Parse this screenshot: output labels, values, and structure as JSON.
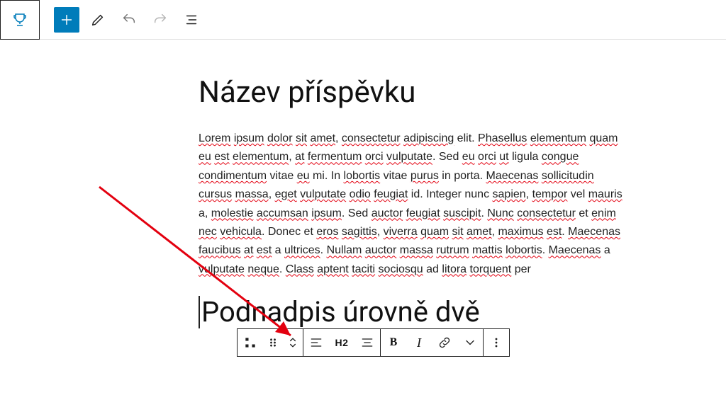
{
  "title": "Název příspěvku",
  "paragraph_spans": [
    {
      "t": "Lorem",
      "s": 1
    },
    {
      "t": " ",
      "s": 0
    },
    {
      "t": "ipsum",
      "s": 1
    },
    {
      "t": " ",
      "s": 0
    },
    {
      "t": "dolor",
      "s": 1
    },
    {
      "t": " ",
      "s": 0
    },
    {
      "t": "sit",
      "s": 1
    },
    {
      "t": " ",
      "s": 0
    },
    {
      "t": "amet",
      "s": 1
    },
    {
      "t": ", ",
      "s": 0
    },
    {
      "t": "consectetur",
      "s": 1
    },
    {
      "t": " ",
      "s": 0
    },
    {
      "t": "adipiscing",
      "s": 1
    },
    {
      "t": " elit. ",
      "s": 0
    },
    {
      "t": "Phasellus",
      "s": 1
    },
    {
      "t": " ",
      "s": 0
    },
    {
      "t": "elementum",
      "s": 1
    },
    {
      "t": " ",
      "s": 0
    },
    {
      "t": "quam",
      "s": 1
    },
    {
      "t": " ",
      "s": 0
    },
    {
      "t": "eu",
      "s": 1
    },
    {
      "t": " ",
      "s": 0
    },
    {
      "t": "est",
      "s": 1
    },
    {
      "t": " ",
      "s": 0
    },
    {
      "t": "elementum",
      "s": 1
    },
    {
      "t": ", ",
      "s": 0
    },
    {
      "t": "at",
      "s": 1
    },
    {
      "t": " ",
      "s": 0
    },
    {
      "t": "fermentum",
      "s": 1
    },
    {
      "t": " ",
      "s": 0
    },
    {
      "t": "orci",
      "s": 1
    },
    {
      "t": " ",
      "s": 0
    },
    {
      "t": "vulputate",
      "s": 1
    },
    {
      "t": ". Sed ",
      "s": 0
    },
    {
      "t": "eu",
      "s": 1
    },
    {
      "t": " ",
      "s": 0
    },
    {
      "t": "orci",
      "s": 1
    },
    {
      "t": " ",
      "s": 0
    },
    {
      "t": "ut",
      "s": 1
    },
    {
      "t": " ligula ",
      "s": 0
    },
    {
      "t": "congue",
      "s": 1
    },
    {
      "t": " ",
      "s": 0
    },
    {
      "t": "condimentum",
      "s": 1
    },
    {
      "t": " vitae ",
      "s": 0
    },
    {
      "t": "eu",
      "s": 1
    },
    {
      "t": " mi. In ",
      "s": 0
    },
    {
      "t": "lobortis",
      "s": 1
    },
    {
      "t": " vitae ",
      "s": 0
    },
    {
      "t": "purus",
      "s": 1
    },
    {
      "t": " in porta. ",
      "s": 0
    },
    {
      "t": "Maecenas",
      "s": 1
    },
    {
      "t": " ",
      "s": 0
    },
    {
      "t": "sollicitudin",
      "s": 1
    },
    {
      "t": " ",
      "s": 0
    },
    {
      "t": "cursus",
      "s": 1
    },
    {
      "t": " ",
      "s": 0
    },
    {
      "t": "massa",
      "s": 1
    },
    {
      "t": ", ",
      "s": 0
    },
    {
      "t": "eget",
      "s": 1
    },
    {
      "t": " ",
      "s": 0
    },
    {
      "t": "vulputate",
      "s": 1
    },
    {
      "t": " ",
      "s": 0
    },
    {
      "t": "odio",
      "s": 1
    },
    {
      "t": " ",
      "s": 0
    },
    {
      "t": "feugiat",
      "s": 1
    },
    {
      "t": " id. Integer nunc ",
      "s": 0
    },
    {
      "t": "sapien",
      "s": 1
    },
    {
      "t": ", ",
      "s": 0
    },
    {
      "t": "tempor",
      "s": 1
    },
    {
      "t": " vel ",
      "s": 0
    },
    {
      "t": "mauris",
      "s": 1
    },
    {
      "t": " a, ",
      "s": 0
    },
    {
      "t": "molestie",
      "s": 1
    },
    {
      "t": " ",
      "s": 0
    },
    {
      "t": "accumsan",
      "s": 1
    },
    {
      "t": " ",
      "s": 0
    },
    {
      "t": "ipsum",
      "s": 1
    },
    {
      "t": ". Sed ",
      "s": 0
    },
    {
      "t": "auctor",
      "s": 1
    },
    {
      "t": " ",
      "s": 0
    },
    {
      "t": "feugiat",
      "s": 1
    },
    {
      "t": " ",
      "s": 0
    },
    {
      "t": "suscipit",
      "s": 1
    },
    {
      "t": ". ",
      "s": 0
    },
    {
      "t": "Nunc",
      "s": 1
    },
    {
      "t": " ",
      "s": 0
    },
    {
      "t": "consectetur",
      "s": 1
    },
    {
      "t": " et ",
      "s": 0
    },
    {
      "t": "enim",
      "s": 1
    },
    {
      "t": " ",
      "s": 0
    },
    {
      "t": "nec",
      "s": 1
    },
    {
      "t": " ",
      "s": 0
    },
    {
      "t": "vehicula",
      "s": 1
    },
    {
      "t": ". Donec et ",
      "s": 0
    },
    {
      "t": "eros",
      "s": 1
    },
    {
      "t": " ",
      "s": 0
    },
    {
      "t": "sagittis",
      "s": 1
    },
    {
      "t": ", ",
      "s": 0
    },
    {
      "t": "viverra",
      "s": 1
    },
    {
      "t": " ",
      "s": 0
    },
    {
      "t": "quam",
      "s": 1
    },
    {
      "t": " ",
      "s": 0
    },
    {
      "t": "sit",
      "s": 1
    },
    {
      "t": " ",
      "s": 0
    },
    {
      "t": "amet",
      "s": 1
    },
    {
      "t": ", ",
      "s": 0
    },
    {
      "t": "maximus",
      "s": 1
    },
    {
      "t": " ",
      "s": 0
    },
    {
      "t": "est",
      "s": 1
    },
    {
      "t": ". ",
      "s": 0
    },
    {
      "t": "Maecenas",
      "s": 1
    },
    {
      "t": " ",
      "s": 0
    },
    {
      "t": "faucibus",
      "s": 1
    },
    {
      "t": " ",
      "s": 0
    },
    {
      "t": "at",
      "s": 1
    },
    {
      "t": " ",
      "s": 0
    },
    {
      "t": "est",
      "s": 1
    },
    {
      "t": " a ",
      "s": 0
    },
    {
      "t": "ultrices",
      "s": 1
    },
    {
      "t": ". ",
      "s": 0
    },
    {
      "t": "Nullam",
      "s": 1
    },
    {
      "t": " ",
      "s": 0
    },
    {
      "t": "auctor",
      "s": 1
    },
    {
      "t": " ",
      "s": 0
    },
    {
      "t": "massa",
      "s": 1
    },
    {
      "t": " ",
      "s": 0
    },
    {
      "t": "rutrum",
      "s": 1
    },
    {
      "t": " ",
      "s": 0
    },
    {
      "t": "mattis",
      "s": 1
    },
    {
      "t": " ",
      "s": 0
    },
    {
      "t": "lobortis",
      "s": 1
    },
    {
      "t": ". ",
      "s": 0
    },
    {
      "t": "Maecenas",
      "s": 1
    },
    {
      "t": " a ",
      "s": 0
    },
    {
      "t": "vulputate",
      "s": 1
    },
    {
      "t": " ",
      "s": 0
    },
    {
      "t": "neque",
      "s": 1
    },
    {
      "t": ". ",
      "s": 0
    },
    {
      "t": "Class",
      "s": 1
    },
    {
      "t": " ",
      "s": 0
    },
    {
      "t": "aptent",
      "s": 1
    },
    {
      "t": " ",
      "s": 0
    },
    {
      "t": "taciti",
      "s": 1
    },
    {
      "t": " ",
      "s": 0
    },
    {
      "t": "sociosqu",
      "s": 1
    },
    {
      "t": " ad ",
      "s": 0
    },
    {
      "t": "litora",
      "s": 1
    },
    {
      "t": " ",
      "s": 0
    },
    {
      "t": "torquent",
      "s": 1
    },
    {
      "t": " per",
      "s": 0
    }
  ],
  "block_toolbar": {
    "heading_level": "H2",
    "bold": "B",
    "italic": "I"
  },
  "subheading": "Podnadpis úrovně dvě"
}
